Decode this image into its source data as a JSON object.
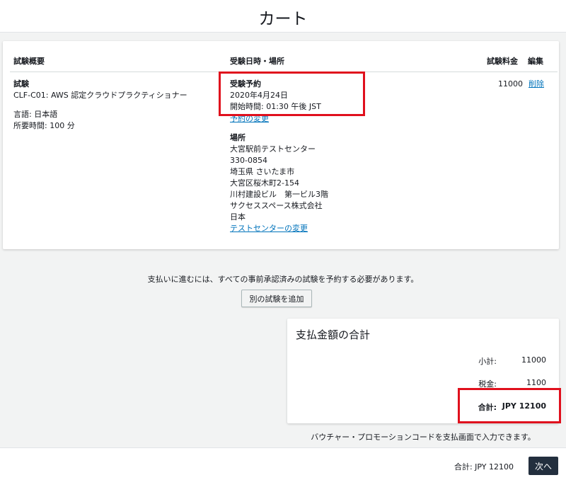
{
  "page": {
    "title": "カート"
  },
  "table": {
    "headers": {
      "overview": "試験概要",
      "datetime_location": "受験日時・場所",
      "fee": "試験料金",
      "edit": "編集"
    },
    "row": {
      "exam_label": "試験",
      "exam_name": "CLF-C01: AWS 認定クラウドプラクティショナー",
      "language": "言語: 日本語",
      "duration": "所要時間: 100 分",
      "booking_label": "受験予約",
      "booking_date": "2020年4月24日",
      "booking_time": "開始時間: 01:30 午後 JST",
      "change_booking_link": "予約の変更",
      "location_label": "場所",
      "location_lines": [
        "大宮駅前テストセンター",
        "330-0854",
        "埼玉県 さいたま市",
        "大宮区桜木町2-154",
        "川村建設ビル　第一ビル3階",
        "サクセススペース株式会社",
        "日本"
      ],
      "change_center_link": "テストセンターの変更",
      "fee": "11000",
      "delete_link": "削除"
    }
  },
  "notice": {
    "text": "支払いに進むには、すべての事前承認済みの試験を予約する必要があります。",
    "add_exam_button": "別の試験を追加"
  },
  "summary": {
    "title": "支払金額の合計",
    "subtotal_label": "小計:",
    "subtotal_value": "11000",
    "tax_label": "税金:",
    "tax_value": "1100",
    "total_label": "合計:",
    "total_value": "JPY 12100"
  },
  "voucher_note": "バウチャー・プロモーションコードを支払画面で入力できます。",
  "footer": {
    "total_text": "合計: JPY 12100",
    "next_button": "次へ"
  },
  "colors": {
    "highlight": "#e0101d",
    "link": "#0073bb",
    "primary_button": "#232f3e"
  }
}
